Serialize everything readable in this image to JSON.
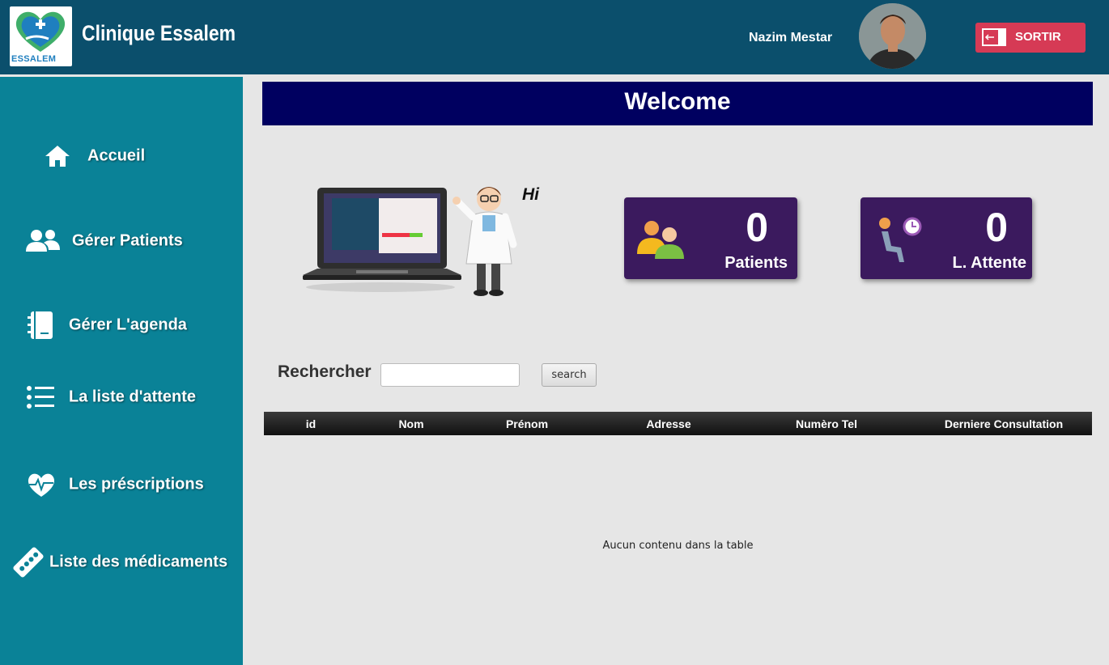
{
  "header": {
    "logo_text": "ESSALEM",
    "app_title": "Clinique Essalem",
    "user_name": "Nazim Mestar",
    "sortir_label": "SORTIR"
  },
  "sidebar": {
    "items": [
      {
        "label": "Accueil",
        "icon": "home-icon"
      },
      {
        "label": "Gérer Patients",
        "icon": "users-icon"
      },
      {
        "label": "Gérer L'agenda",
        "icon": "notebook-icon"
      },
      {
        "label": "La liste d'attente",
        "icon": "list-icon"
      },
      {
        "label": "Les préscriptions",
        "icon": "heart-pulse-icon"
      },
      {
        "label": "Liste des médicaments",
        "icon": "pills-icon"
      }
    ]
  },
  "main": {
    "welcome": "Welcome",
    "hi": "Hi",
    "stats": [
      {
        "value": "0",
        "label": "Patients",
        "icon": "patients-icon"
      },
      {
        "value": "0",
        "label": "L. Attente",
        "icon": "waiting-icon"
      }
    ],
    "search": {
      "label": "Rechercher",
      "value": "",
      "button": "search"
    },
    "table": {
      "columns": [
        "id",
        "Nom",
        "Prénom",
        "Adresse",
        "Numèro Tel",
        "Derniere Consultation"
      ],
      "empty_message": "Aucun contenu dans la table"
    }
  },
  "colors": {
    "header_bg": "#0b4f6c",
    "sidebar_bg": "#0a8297",
    "welcome_bg": "#000060",
    "card_bg": "#3b1a5e",
    "sortir_bg": "#d63a55"
  }
}
